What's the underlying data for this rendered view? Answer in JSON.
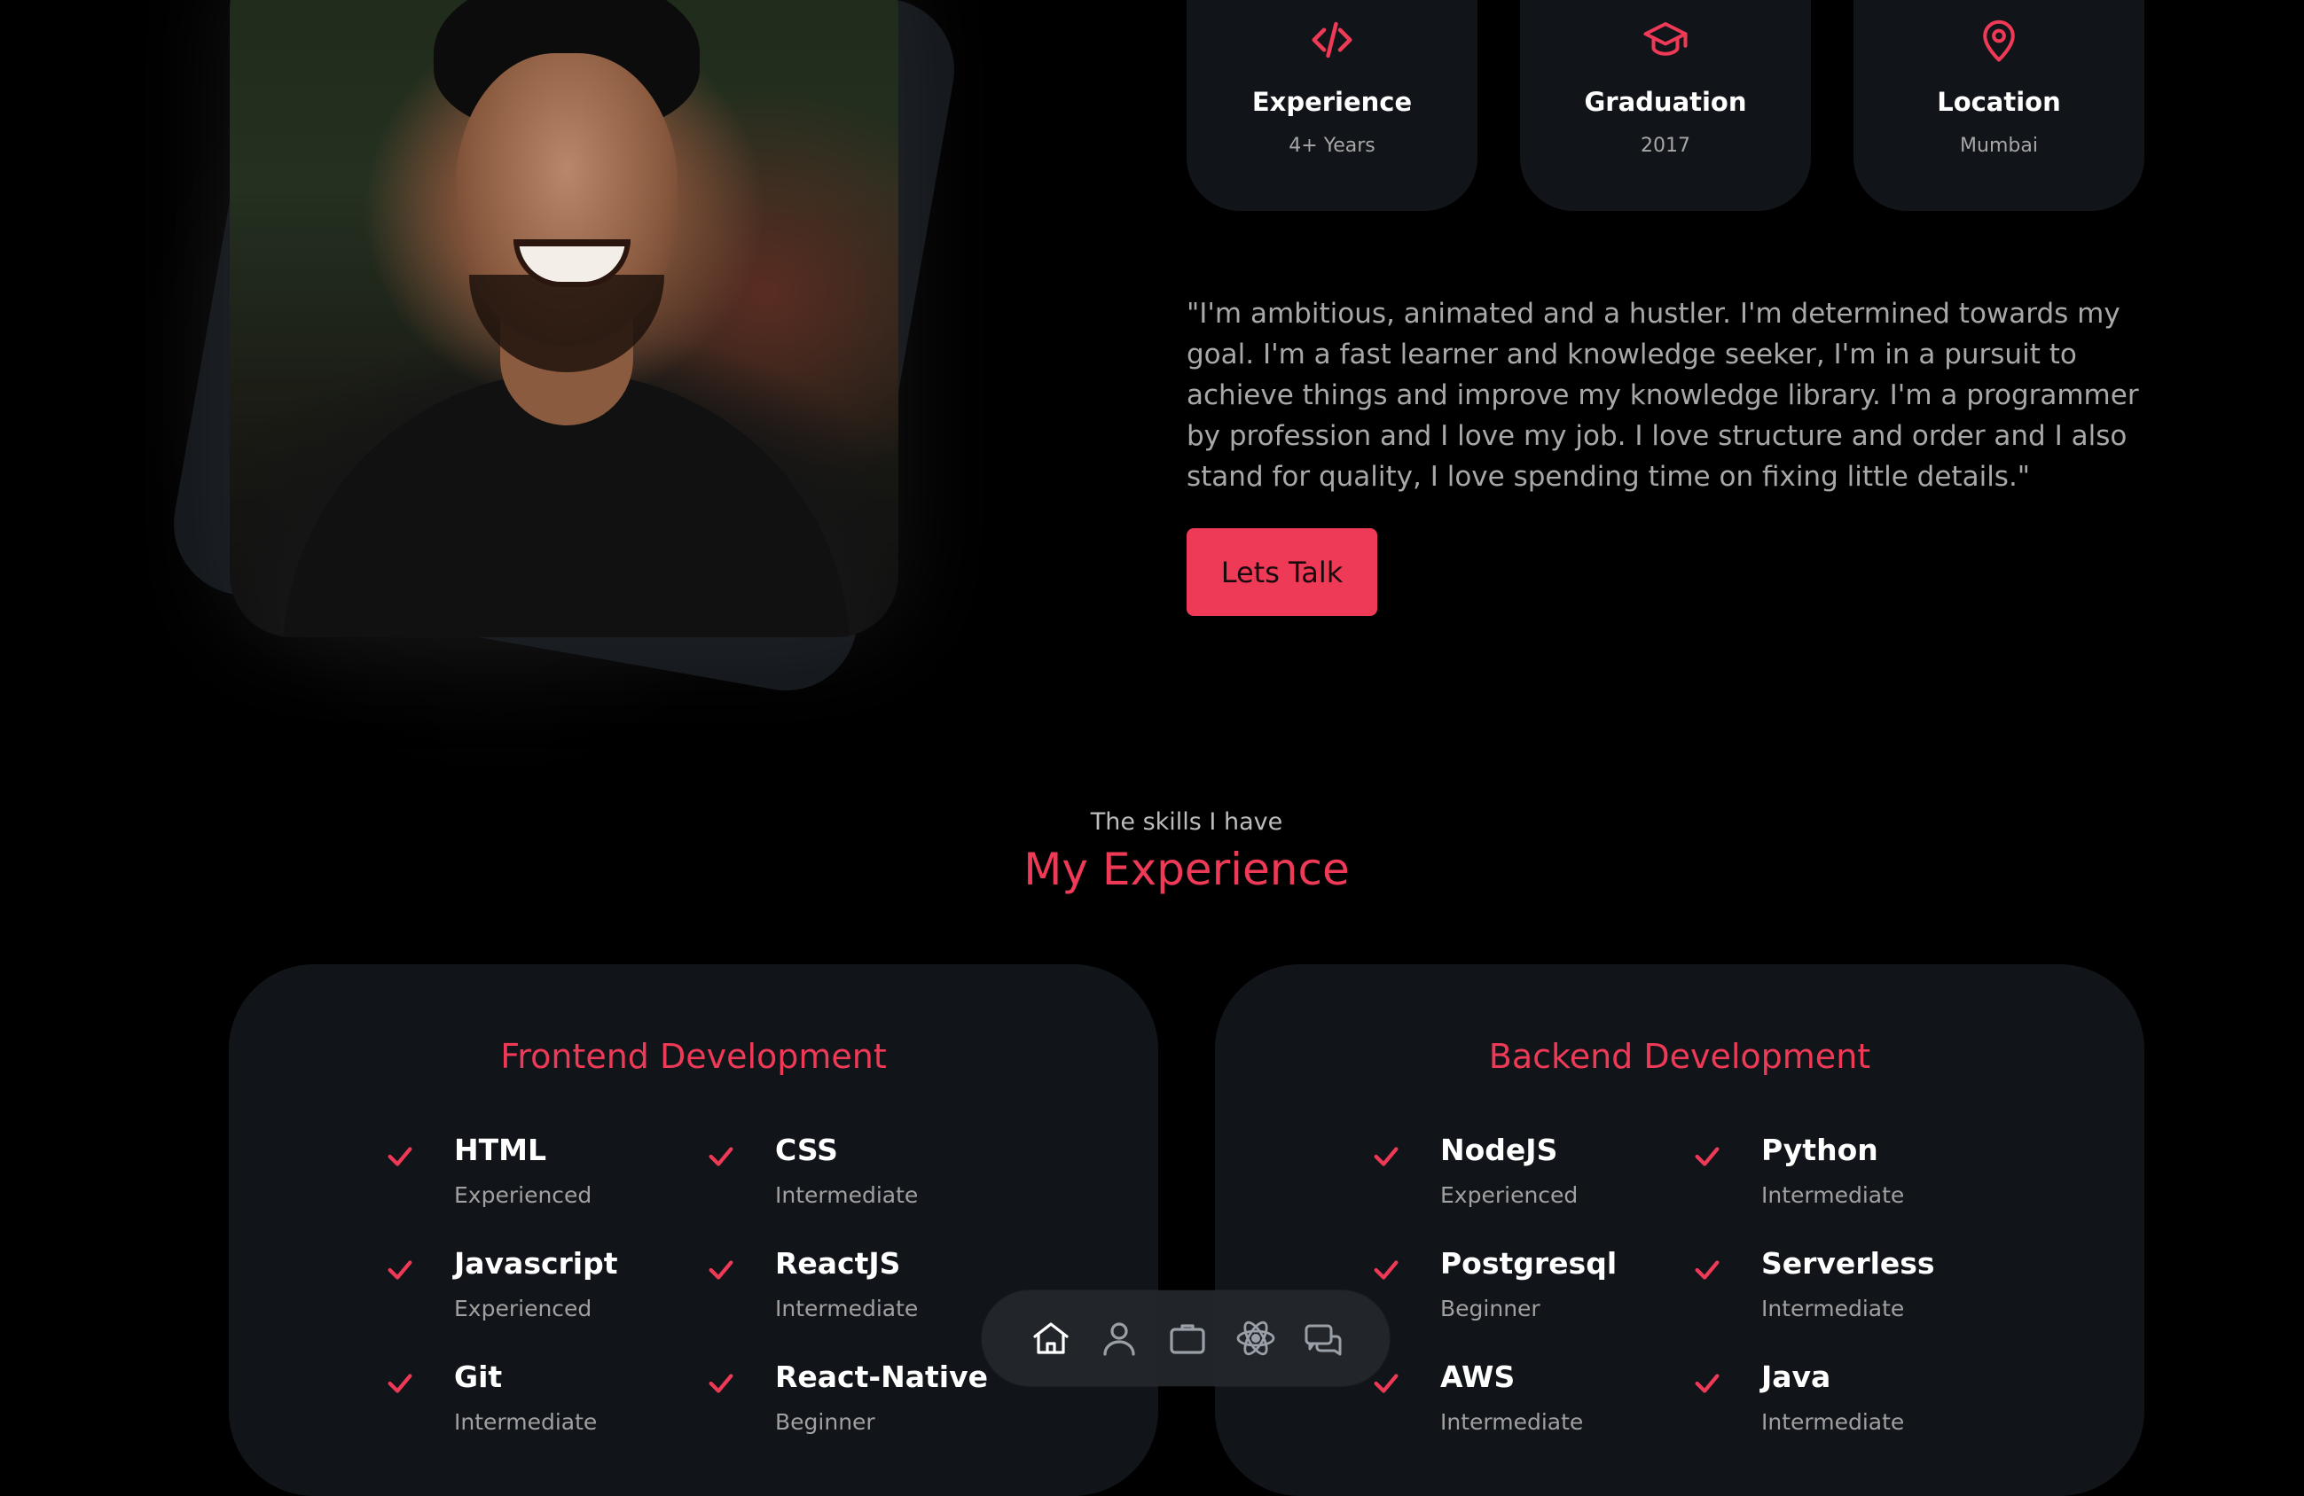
{
  "about": {
    "cards": [
      {
        "icon": "code-icon",
        "title": "Experience",
        "subtitle": "4+ Years"
      },
      {
        "icon": "graduation-cap-icon",
        "title": "Graduation",
        "subtitle": "2017"
      },
      {
        "icon": "location-pin-icon",
        "title": "Location",
        "subtitle": "Mumbai"
      }
    ],
    "bio": "\"I'm ambitious, animated and a hustler. I'm determined towards my goal. I'm a fast learner and knowledge seeker, I'm in a pursuit to achieve things and improve my knowledge library. I'm a programmer by profession and I love my job. I love structure and order and I also stand for quality, I love spending time on fixing little details.\"",
    "cta_label": "Lets Talk"
  },
  "experience": {
    "subtitle": "The skills I have",
    "title": "My Experience",
    "frontend": {
      "title": "Frontend Development",
      "skills": [
        {
          "name": "HTML",
          "level": "Experienced"
        },
        {
          "name": "CSS",
          "level": "Intermediate"
        },
        {
          "name": "Javascript",
          "level": "Experienced"
        },
        {
          "name": "ReactJS",
          "level": "Intermediate"
        },
        {
          "name": "Git",
          "level": "Intermediate"
        },
        {
          "name": "React-Native",
          "level": "Beginner"
        }
      ]
    },
    "backend": {
      "title": "Backend Development",
      "skills": [
        {
          "name": "NodeJS",
          "level": "Experienced"
        },
        {
          "name": "Python",
          "level": "Intermediate"
        },
        {
          "name": "Postgresql",
          "level": "Beginner"
        },
        {
          "name": "Serverless",
          "level": "Intermediate"
        },
        {
          "name": "AWS",
          "level": "Intermediate"
        },
        {
          "name": "Java",
          "level": "Intermediate"
        }
      ]
    }
  },
  "nav": {
    "items": [
      "home-icon",
      "user-icon",
      "briefcase-icon",
      "atom-icon",
      "chat-icon"
    ]
  },
  "colors": {
    "accent": "#ef3a57",
    "card": "#111418",
    "background": "#000000"
  }
}
